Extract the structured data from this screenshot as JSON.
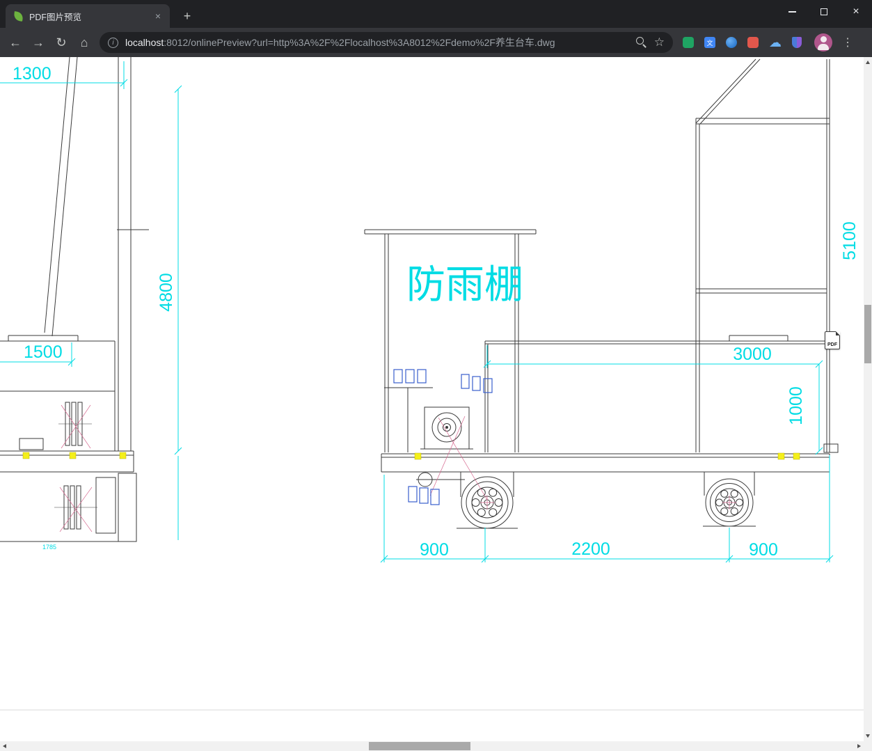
{
  "window": {
    "tab_title": "PDF图片预览",
    "new_tab_glyph": "+",
    "close_glyph": "×"
  },
  "toolbar": {
    "back_glyph": "←",
    "forward_glyph": "→",
    "reload_glyph": "↻",
    "home_glyph": "⌂",
    "star_glyph": "☆",
    "menu_glyph": "⋮",
    "info_glyph": "i",
    "translate_glyph": "文",
    "url_host": "localhost",
    "url_rest": ":8012/onlinePreview?url=http%3A%2F%2Flocalhost%3A8012%2Fdemo%2F养生台车.dwg"
  },
  "drawing": {
    "canopy_label": "防雨棚",
    "pdf_badge": "PDF",
    "dims": {
      "left_top_width": "1300",
      "mast_height": "4800",
      "base_width": "1500",
      "base_detail": "1785",
      "right_height": "5100",
      "bed_length": "3000",
      "bed_height": "1000",
      "span_left": "900",
      "span_center": "2200",
      "span_right": "900"
    },
    "colors": {
      "dimension_cyan": "#00dce4",
      "line_dark": "#3a3a3a",
      "accent_blue": "#3a5fcd",
      "highlight_yellow": "#f4ef1b",
      "accent_red": "#d6688f"
    }
  }
}
